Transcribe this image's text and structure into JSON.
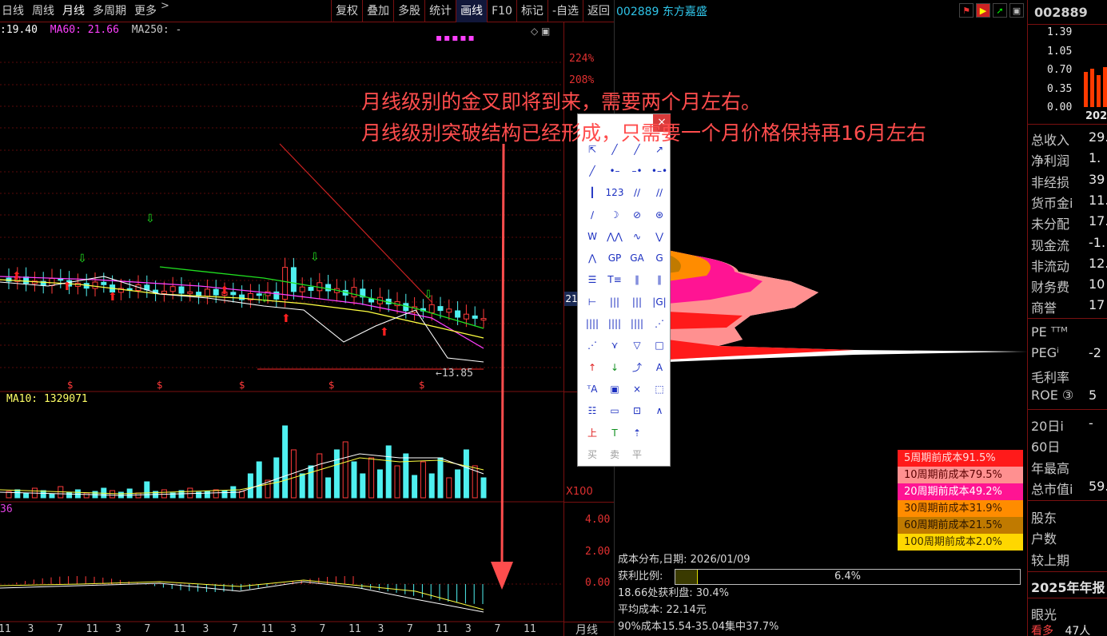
{
  "toolbar": {
    "left": [
      "日线",
      "周线",
      "月线",
      "多周期",
      "更多"
    ],
    "active": "月线",
    "right": [
      "复权",
      "叠加",
      "多股",
      "统计",
      "画线",
      "F10",
      "标记",
      "-自选",
      "返回"
    ],
    "highlighted": "画线"
  },
  "ma_legend": {
    "ma30": ":19.40",
    "ma60": "MA60: 21.66",
    "ma250": "MA250: -"
  },
  "price_axis": [
    "224%",
    "208%"
  ],
  "current_price_tag": "21",
  "low_marker": "13.85",
  "volume_legend": "MA10: 1329071",
  "volume_scale": "X100",
  "macd_legend": "36",
  "macd_axis": [
    "4.00",
    "2.00",
    "0.00"
  ],
  "bottom_dates": [
    "11",
    "3",
    "7",
    "11",
    "3",
    "7",
    "11",
    "3",
    "7",
    "11",
    "3",
    "7",
    "11",
    "3",
    "7",
    "11",
    "3",
    "7",
    "11"
  ],
  "period_label": "月线",
  "chip": {
    "title": "002889 东方嘉盛",
    "costs": [
      {
        "label": "5周期前成本91.5%",
        "bg": "#ff1a1a",
        "fg": "#ffdddd"
      },
      {
        "label": "10周期前成本79.5%",
        "bg": "#ff9090",
        "fg": "#5a0000"
      },
      {
        "label": "20周期前成本49.2%",
        "bg": "#ff1493",
        "fg": "#ffffff"
      },
      {
        "label": "30周期前成本31.9%",
        "bg": "#ff8c00",
        "fg": "#3a1a00"
      },
      {
        "label": "60周期前成本21.5%",
        "bg": "#c07a00",
        "fg": "#2a1500"
      },
      {
        "label": "100周期前成本2.0%",
        "bg": "#ffd700",
        "fg": "#3a2a00"
      }
    ],
    "dist_date": "成本分布,日期: 2026/01/09",
    "profit_label": "获利比例:",
    "profit_value": "6.4%",
    "profit_ratio": 0.064,
    "profit_at": "18.66处获利盘: 30.4%",
    "avg_cost": "平均成本: 22.14元",
    "cost_90": "90%成本15.54-35.04集中37.7%"
  },
  "info": {
    "code": "002889",
    "mini_axis": [
      "1.39",
      "1.05",
      "0.70",
      "0.35",
      "0.00"
    ],
    "mini_year": "202",
    "rows": [
      {
        "k": "总收入",
        "v": "29."
      },
      {
        "k": "净利润",
        "v": "1."
      },
      {
        "k": "非经损",
        "v": "39"
      },
      {
        "k": "货币金i",
        "v": "11."
      },
      {
        "k": "未分配",
        "v": "17."
      },
      {
        "k": "现金流",
        "v": "-1."
      },
      {
        "k": "非流动",
        "v": "12."
      },
      {
        "k": "财务费",
        "v": "10"
      },
      {
        "k": "商誉",
        "v": "17"
      }
    ],
    "rows2": [
      {
        "k": "PE ᵀᵀᴹ",
        "v": ""
      },
      {
        "k": "PEGⁱ",
        "v": "-2"
      },
      {
        "k": "毛利率",
        "v": ""
      },
      {
        "k": "ROE ③",
        "v": "5"
      }
    ],
    "rows3": [
      {
        "k": "20日i",
        "v": "-"
      },
      {
        "k": "60日",
        "v": ""
      },
      {
        "k": "年最高",
        "v": ""
      },
      {
        "k": "总市值i",
        "v": "59."
      }
    ],
    "rows4": [
      {
        "k": "股东",
        "v": ""
      },
      {
        "k": "户数",
        "v": ""
      },
      {
        "k": "较上期",
        "v": ""
      }
    ],
    "report": "2025年年报",
    "bottom1": "眼光",
    "bottom2": "看多",
    "bottom2_v": "47人"
  },
  "toolbox": {
    "close": "×",
    "tools": [
      "⇱",
      "╱",
      "╱",
      "↗",
      "╱",
      "•–",
      "–•",
      "•–•",
      "┃",
      "123",
      "∕∕",
      "∕∕",
      "∕",
      "☽",
      "⊘",
      "⊛",
      "W",
      "⋀⋀",
      "∿",
      "⋁",
      "⋀",
      "GP",
      "GA",
      "G",
      "☰",
      "T≡",
      "∥",
      "∥",
      "⊢",
      "|||",
      "|||",
      "|G|",
      "||||",
      "||||",
      "||||",
      "⋰",
      "⋰",
      "⋎",
      "▽",
      "□",
      "↑",
      "↓",
      "⤴",
      "A",
      "ᵀA",
      "▣",
      "×",
      "⬚",
      "☷",
      "▭",
      "⊡",
      "∧",
      "上",
      "T",
      "⇡",
      "",
      "买",
      "卖",
      "平",
      ""
    ]
  },
  "annotation": {
    "line1": "月线级别的金叉即将到来，需要两个月左右。",
    "line2": "月线级别突破结构已经形成，只需要一个月价格保持再16月左右"
  }
}
